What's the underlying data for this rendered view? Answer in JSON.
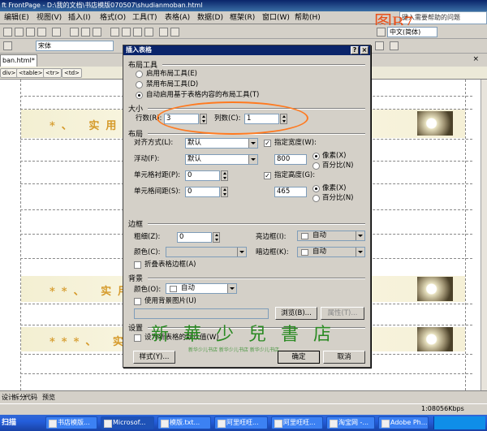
{
  "window": {
    "title": "ft FrontPage - D:\\我的文档\\书店模版070507\\shudianmoban.html"
  },
  "menu": [
    "编辑(E)",
    "视图(V)",
    "插入(I)",
    "格式(O)",
    "工具(T)",
    "表格(A)",
    "数据(D)",
    "框架(R)",
    "窗口(W)",
    "帮助(H)"
  ],
  "help_box": "键入需要帮助的问题",
  "figure_label": "图B7",
  "toolbar": {
    "font_name": "宋体",
    "ime_label": "中文(简体)"
  },
  "doc_tab": "ban.html*",
  "tag_path": [
    "div>",
    "<table>",
    "<tr>",
    "<td>"
  ],
  "page_bands": [
    "*、 实用",
    "**、 实用",
    "***、 实用"
  ],
  "dialog": {
    "title": "插入表格",
    "layout_tools": {
      "heading": "布局工具",
      "options": [
        "启用布局工具(E)",
        "禁用布局工具(D)",
        "自动启用基于表格内容的布局工具(T)"
      ],
      "selected": 2
    },
    "size": {
      "heading": "大小",
      "rows_label": "行数(R):",
      "rows": "3",
      "cols_label": "列数(C):",
      "cols": "1"
    },
    "layout": {
      "heading": "布局",
      "align_label": "对齐方式(L):",
      "align_value": "默认",
      "float_label": "浮动(F):",
      "float_value": "默认",
      "padding_label": "单元格衬距(P):",
      "padding_value": "0",
      "spacing_label": "单元格间距(S):",
      "spacing_value": "0",
      "width_label": "指定宽度(W):",
      "width_value": "800",
      "height_label": "指定高度(G):",
      "height_value": "465",
      "pixels": "像素(X)",
      "percent": "百分比(N)",
      "pixels2": "像素(X)",
      "percent2": "百分比(N)"
    },
    "border": {
      "heading": "边框",
      "size_label": "粗细(Z):",
      "size_value": "0",
      "color_label": "颜色(C):",
      "color_value": "",
      "light_label": "亮边框(I):",
      "light_value": "自动",
      "dark_label": "暗边框(K):",
      "dark_value": "自动",
      "collapse_label": "折叠表格边框(A)"
    },
    "background": {
      "heading": "背景",
      "color_label": "颜色(O):",
      "color_value": "自动",
      "use_image_label": "使用背景图片(U)",
      "browse": "浏览(B)...",
      "properties": "属性(T)..."
    },
    "set": {
      "heading": "设置",
      "default_label": "设为新表格的默认值(W)"
    },
    "buttons": {
      "style": "样式(Y)...",
      "ok": "确定",
      "cancel": "取消"
    }
  },
  "watermark": {
    "text": "新華少兒書店",
    "subtitle": "新华少儿书店 新华少儿书店 新华少儿书店"
  },
  "view_tabs": [
    "设计",
    "拆分",
    "代码",
    "预览"
  ],
  "status": {
    "speed": "1:08056Kbps"
  },
  "taskbar": {
    "start_label": "扫描",
    "tasks": [
      "书店模版...",
      "Microsof...",
      "模版.txt...",
      "阿里旺旺...",
      "阿里旺旺...",
      "淘宝网 -...",
      "Adobe Ph..."
    ]
  },
  "colors": {
    "annotation": "#ff7a20",
    "figure_label": "#e8501a",
    "watermark": "#2a8a22",
    "band_text": "#d59a2a"
  }
}
